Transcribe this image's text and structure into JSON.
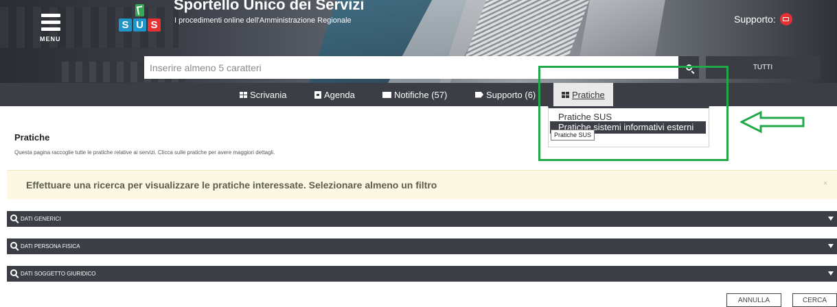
{
  "header": {
    "menu_label": "MENU",
    "logo_letters": [
      "S",
      "U",
      "S"
    ],
    "title": "Sportello Unico dei Servizi",
    "subtitle": "I procedimenti online dell'Amministrazione Regionale",
    "support_label": "Supporto:",
    "search_placeholder": "Inserire almeno 5 caratteri",
    "scope_button": "TUTTI"
  },
  "nav": {
    "items": [
      {
        "label": "Scrivania",
        "icon": "grid-icon"
      },
      {
        "label": "Agenda",
        "icon": "agenda-icon"
      },
      {
        "label": "Notifiche (57)",
        "icon": "envelope-icon"
      },
      {
        "label": "Supporto (6)",
        "icon": "tag-icon"
      },
      {
        "label": "Pratiche",
        "icon": "grid-icon",
        "active": true
      }
    ]
  },
  "dropdown": {
    "items": [
      "Pratiche SUS",
      "Pratiche sistemi informativi esterni"
    ],
    "tooltip": "Pratiche SUS"
  },
  "content": {
    "title": "Pratiche",
    "description": "Questa pagina raccoglie tutte le pratiche relative ai servizi. Clicca sulle pratiche per avere maggiori dettagli.",
    "alert": "Effettuare una ricerca per visualizzare le pratiche interessate. Selezionare almeno un filtro",
    "alert_close": "×",
    "sections": [
      "DATI GENERICI",
      "DATI PERSONA FISICA",
      "DATI SOGGETTO GIURIDICO"
    ],
    "buttons": {
      "cancel": "ANNULLA",
      "search": "CERCA"
    }
  },
  "colors": {
    "nav_bg": "#3b3e45",
    "highlight": "#22a84a",
    "alert_bg": "#fcf8e3",
    "logo_blue": "#1f95c9",
    "logo_red": "#e63232"
  }
}
